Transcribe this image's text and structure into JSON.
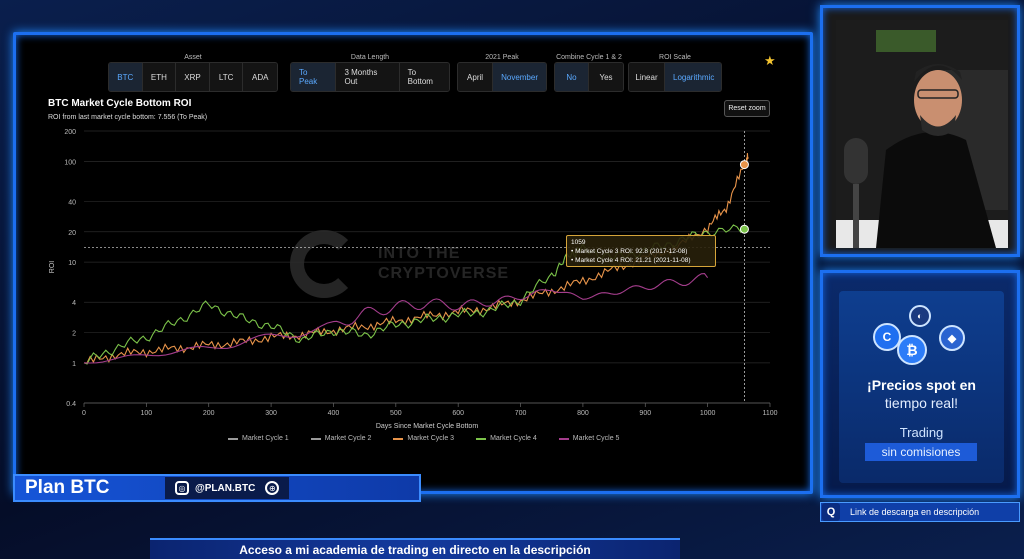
{
  "controls": [
    {
      "title": "Asset",
      "buttons": [
        "BTC",
        "ETH",
        "XRP",
        "LTC",
        "ADA"
      ],
      "active": 0
    },
    {
      "title": "Data Length",
      "buttons": [
        "To Peak",
        "3 Months Out",
        "To Bottom"
      ],
      "active": 0
    },
    {
      "title": "2021 Peak",
      "buttons": [
        "April",
        "November"
      ],
      "active": 1
    },
    {
      "title": "Combine Cycle 1 & 2",
      "buttons": [
        "No",
        "Yes"
      ],
      "active": 0
    },
    {
      "title": "ROI Scale",
      "buttons": [
        "Linear",
        "Logarithmic"
      ],
      "active": 1
    }
  ],
  "chart": {
    "title": "BTC Market Cycle Bottom ROI",
    "subtitle": "ROI from last market cycle bottom: 7.556 (To Peak)",
    "reset_zoom_label": "Reset zoom",
    "watermark_line1": "INTO THE",
    "watermark_line2": "CRYPTOVERSE",
    "tooltip": {
      "header": "1059",
      "line1": "• Market Cycle 3 ROI: 92.8 (2017-12-08)",
      "line2": "• Market Cycle 4 ROI: 21.21 (2021-11-08)"
    }
  },
  "chart_data": {
    "type": "line",
    "title": "BTC Market Cycle Bottom ROI",
    "subtitle": "ROI from last market cycle bottom: 7.556 (To Peak)",
    "xlabel": "Days Since Market Cycle Bottom",
    "ylabel": "ROI",
    "y_scale": "log",
    "xlim": [
      0,
      1100
    ],
    "ylim": [
      0.4,
      200
    ],
    "x_ticks": [
      0,
      100,
      200,
      300,
      400,
      500,
      600,
      700,
      800,
      900,
      1000,
      1100
    ],
    "y_ticks": [
      0.4,
      1,
      2,
      4,
      10,
      20,
      40,
      100,
      200
    ],
    "legend_position": "bottom",
    "series": [
      {
        "name": "Market Cycle 1",
        "color": "#9a9a9a",
        "x": [],
        "y": []
      },
      {
        "name": "Market Cycle 2",
        "color": "#9a9a9a",
        "x": [],
        "y": []
      },
      {
        "name": "Market Cycle 3",
        "color": "#e8944a",
        "x": [
          0,
          50,
          100,
          150,
          200,
          250,
          300,
          350,
          400,
          450,
          500,
          550,
          600,
          650,
          700,
          750,
          800,
          850,
          900,
          950,
          1000,
          1030,
          1059,
          1065
        ],
        "y": [
          1,
          1.2,
          1.3,
          1.4,
          1.5,
          1.6,
          1.8,
          1.9,
          2.1,
          2.3,
          2.6,
          2.9,
          3.2,
          3.5,
          4.2,
          5.2,
          6.5,
          8.5,
          11,
          14,
          22,
          35,
          92.8,
          110
        ]
      },
      {
        "name": "Market Cycle 4",
        "color": "#7cc34a",
        "x": [
          0,
          50,
          100,
          150,
          200,
          250,
          300,
          350,
          400,
          450,
          500,
          550,
          600,
          650,
          700,
          750,
          780,
          800,
          850,
          900,
          950,
          1000,
          1059
        ],
        "y": [
          1,
          1.4,
          1.8,
          2.6,
          3.8,
          2.8,
          2.3,
          1.7,
          2.1,
          1.9,
          2.4,
          2.7,
          3.0,
          3.3,
          4.2,
          7.5,
          12,
          13.5,
          11,
          13,
          16,
          20,
          21.21
        ]
      },
      {
        "name": "Market Cycle 5",
        "color": "#a43d8c",
        "x": [
          0,
          100,
          200,
          300,
          400,
          450,
          500,
          550,
          600,
          650,
          700,
          750,
          800,
          850,
          900,
          950,
          1000
        ],
        "y": [
          1,
          1.2,
          1.4,
          1.8,
          2.3,
          3.1,
          3.6,
          3.9,
          3.7,
          4.0,
          4.5,
          5.4,
          4.4,
          5.0,
          5.7,
          6.3,
          7.0
        ]
      }
    ],
    "tooltip_x": 1059
  },
  "legend": [
    "Market Cycle 1",
    "Market Cycle 2",
    "Market Cycle 3",
    "Market Cycle 4",
    "Market Cycle 5"
  ],
  "brand": {
    "logo": "Plan BTC",
    "handle": "@PLAN.BTC"
  },
  "promo": {
    "headline_line1": "¡Precios spot en",
    "headline_line2": "tiempo real!",
    "trading": "Trading",
    "fees": "sin comisiones",
    "download": "Link de descarga en descripción",
    "download_icon": "Q"
  },
  "footer_banner": "Acceso a mi academia de trading en directo en la descripción",
  "icons": {
    "star": "star-icon",
    "instagram": "instagram-icon",
    "globe": "globe-icon"
  }
}
